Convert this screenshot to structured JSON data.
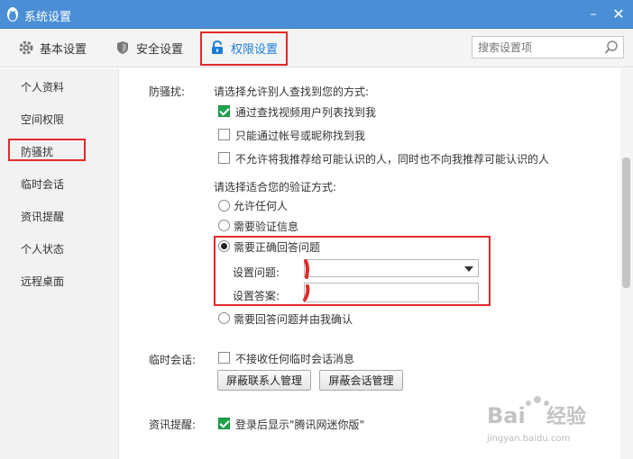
{
  "window": {
    "title": "系统设置",
    "minimize_glyph": "–",
    "close_glyph": "✕"
  },
  "tabs": [
    {
      "label": "基本设置",
      "icon": "gear-icon"
    },
    {
      "label": "安全设置",
      "icon": "shield-icon"
    },
    {
      "label": "权限设置",
      "icon": "lock-icon",
      "active": true
    }
  ],
  "search": {
    "placeholder": "搜索设置项"
  },
  "sidebar": {
    "items": [
      {
        "label": "个人资料"
      },
      {
        "label": "空间权限"
      },
      {
        "label": "防骚扰",
        "active": true
      },
      {
        "label": "临时会话"
      },
      {
        "label": "资讯提醒"
      },
      {
        "label": "个人状态"
      },
      {
        "label": "远程桌面"
      }
    ]
  },
  "anti_harassment": {
    "section_label": "防骚扰:",
    "find_prompt": "请选择允许别人查找到您的方式:",
    "find_options": [
      {
        "label": "通过查找视频用户列表找到我",
        "checked": true
      },
      {
        "label": "只能通过帐号或昵称找到我",
        "checked": false
      },
      {
        "label": "不允许将我推荐给可能认识的人，同时也不向我推荐可能认识的人",
        "checked": false
      }
    ],
    "verify_prompt": "请选择适合您的验证方式:",
    "verify_options": [
      {
        "label": "允许任何人",
        "selected": false
      },
      {
        "label": "需要验证信息",
        "selected": false
      },
      {
        "label": "需要正确回答问题",
        "selected": true
      },
      {
        "label": "需要回答问题并由我确认",
        "selected": false
      }
    ],
    "question_label": "设置问题:",
    "question_value": "",
    "answer_label": "设置答案:",
    "answer_value": ""
  },
  "temp_session": {
    "section_label": "临时会话:",
    "option": {
      "label": "不接收任何临时会话消息",
      "checked": false
    },
    "buttons": [
      "屏蔽联系人管理",
      "屏蔽会话管理"
    ]
  },
  "news_reminder": {
    "section_label": "资讯提醒:",
    "option": {
      "label": "登录后显示\"腾讯网迷你版\"",
      "checked": true
    }
  },
  "colors": {
    "titlebar": "#4a8fd6",
    "active_tab": "#1b7fd6",
    "highlight": "#e12a2a",
    "check": "#1fa44b"
  }
}
